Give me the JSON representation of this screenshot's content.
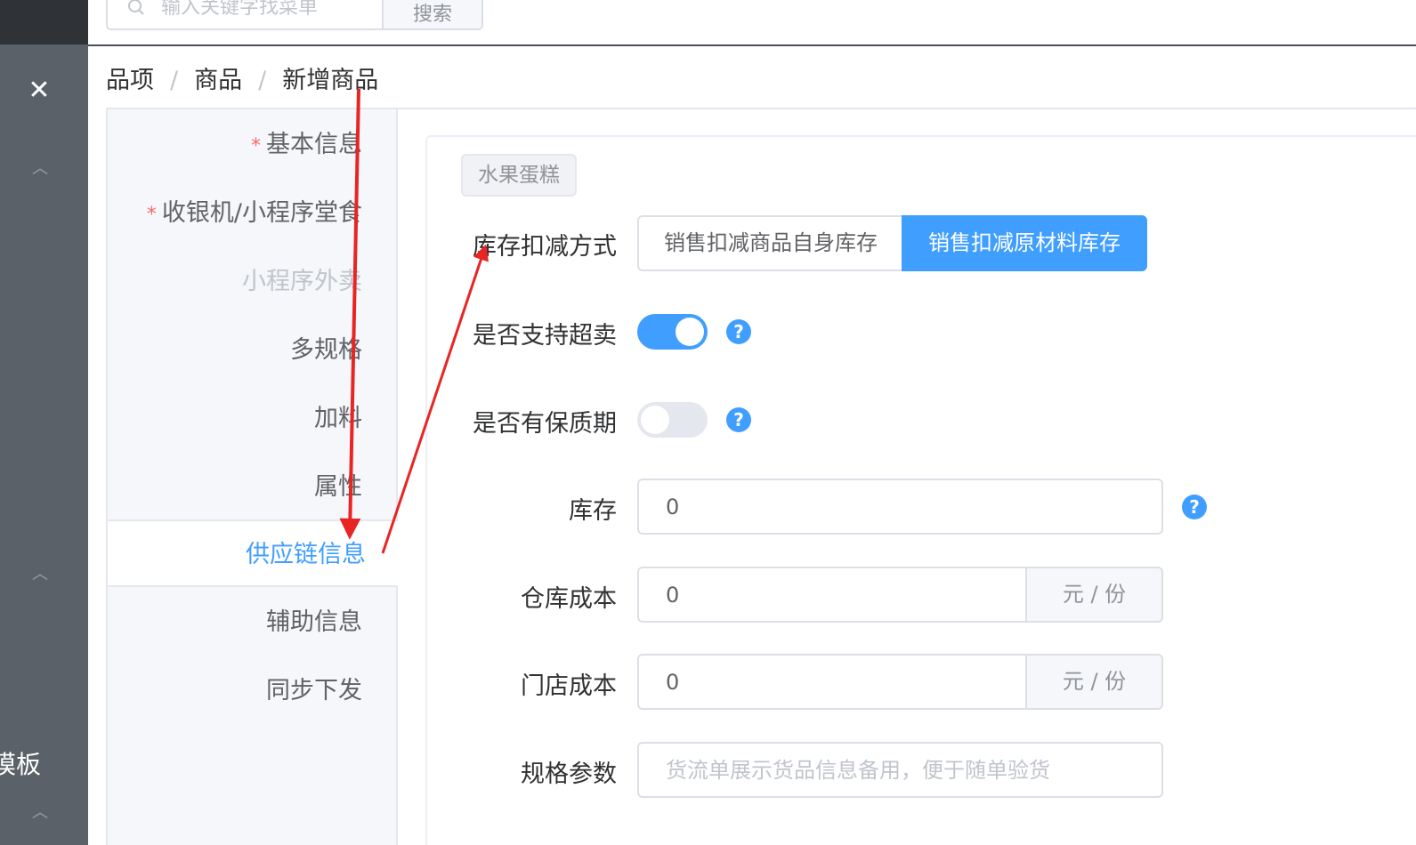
{
  "search": {
    "placeholder": "输入关键字找菜单",
    "button_label": "搜索"
  },
  "sidebar": {
    "close_icon": "close-icon",
    "partial_text": "模板"
  },
  "breadcrumb": {
    "items": [
      "品项",
      "商品",
      "新增商品"
    ],
    "separator": "/"
  },
  "tabs": [
    {
      "label": "基本信息",
      "required": true,
      "state": "normal"
    },
    {
      "label": "收银机/小程序堂食",
      "required": true,
      "state": "normal"
    },
    {
      "label": "小程序外卖",
      "required": false,
      "state": "disabled"
    },
    {
      "label": "多规格",
      "required": false,
      "state": "normal"
    },
    {
      "label": "加料",
      "required": false,
      "state": "normal"
    },
    {
      "label": "属性",
      "required": false,
      "state": "normal"
    },
    {
      "label": "供应链信息",
      "required": false,
      "state": "active"
    },
    {
      "label": "辅助信息",
      "required": false,
      "state": "normal"
    },
    {
      "label": "同步下发",
      "required": false,
      "state": "normal"
    }
  ],
  "form": {
    "product_tag": "水果蛋糕",
    "inventory_method": {
      "label": "库存扣减方式",
      "options": [
        "销售扣减商品自身库存",
        "销售扣减原材料库存"
      ],
      "selected": "销售扣减原材料库存"
    },
    "oversell": {
      "label": "是否支持超卖",
      "on": true
    },
    "shelf_life": {
      "label": "是否有保质期",
      "on": false
    },
    "stock": {
      "label": "库存",
      "value": "0"
    },
    "warehouse_cost": {
      "label": "仓库成本",
      "value": "0",
      "unit": "元 / 份"
    },
    "store_cost": {
      "label": "门店成本",
      "value": "0",
      "unit": "元 / 份"
    },
    "spec_params": {
      "label": "规格参数",
      "placeholder": "货流单展示货品信息备用，便于随单验货"
    },
    "help_glyph": "?"
  },
  "colors": {
    "primary": "#409eff",
    "required": "#f56c6c",
    "annotation": "#e82424",
    "sidebar": "#5b6168"
  }
}
